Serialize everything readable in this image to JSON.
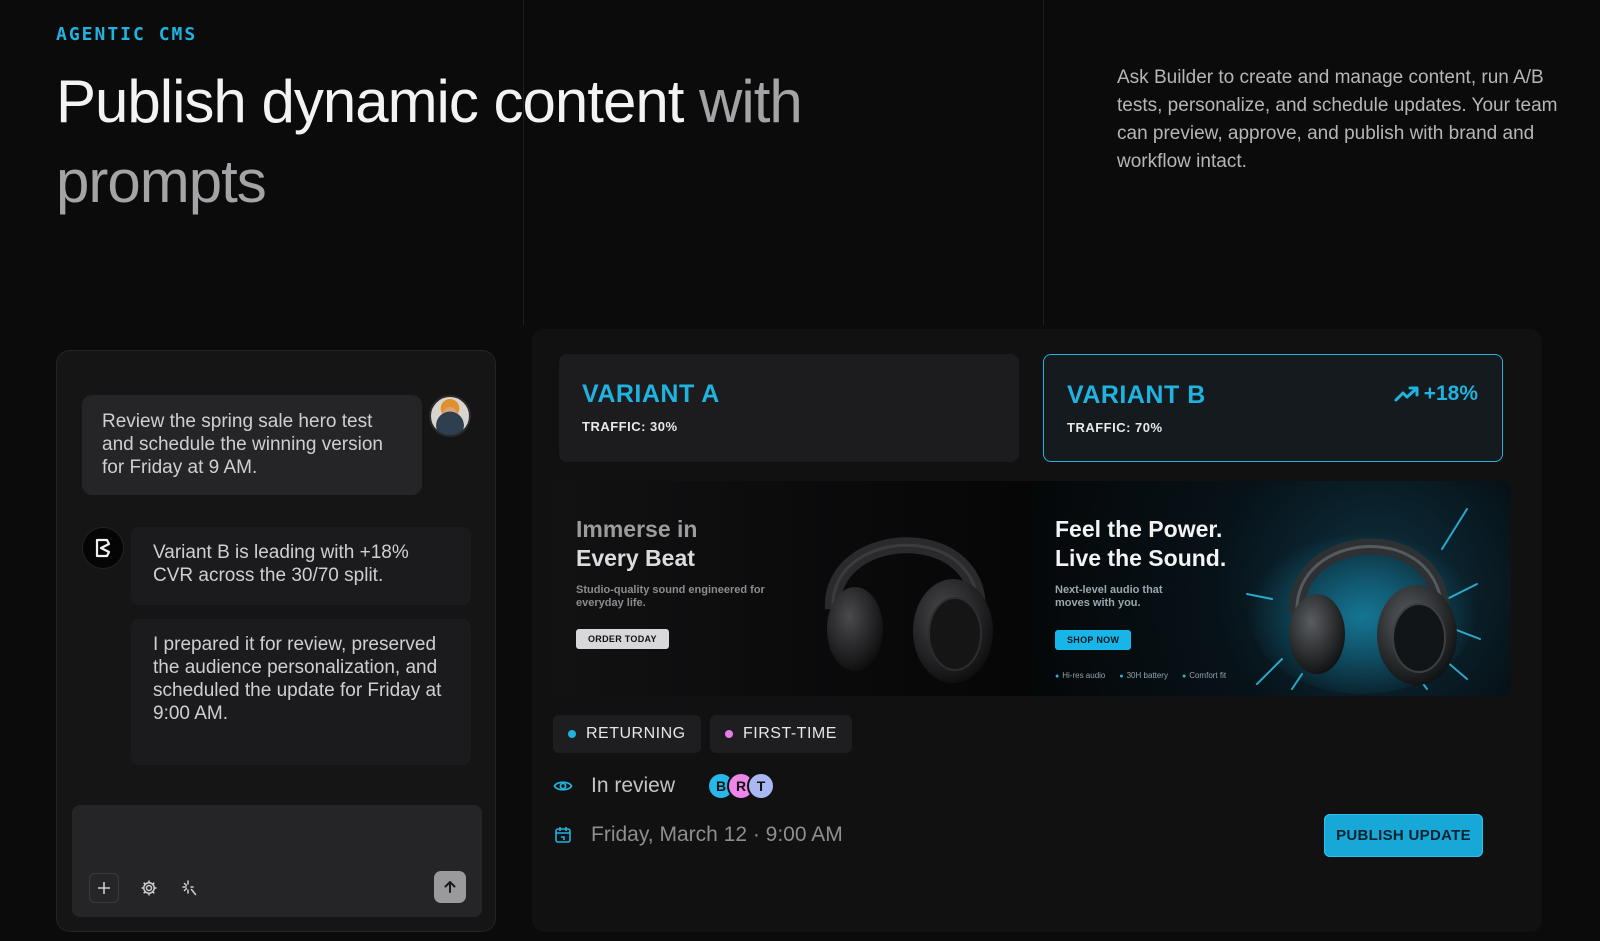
{
  "header": {
    "eyebrow": "AGENTIC CMS",
    "headline_main": "Publish dynamic content ",
    "headline_dim": "with prompts",
    "intro": "Ask Builder to create and manage content, run A/B tests, personalize, and schedule updates. Your team can preview, approve, and publish with brand and workflow intact."
  },
  "chat": {
    "user_message": "Review the spring sale hero test and schedule the winning version for Friday at 9 AM.",
    "bot_messages": [
      "Variant B is leading with +18% CVR across the 30/70 split.",
      "I prepared it for review, preserved the audience personalization, and scheduled the update for Friday at 9:00 AM."
    ],
    "composer_icons": [
      "plus-icon",
      "gear-icon",
      "sparkle-icon",
      "send-arrow-icon"
    ]
  },
  "variants": [
    {
      "title": "VARIANT A",
      "traffic": "TRAFFIC: 30%"
    },
    {
      "title": "VARIANT B",
      "traffic": "TRAFFIC: 70%",
      "lift": "+18%"
    }
  ],
  "hero_a": {
    "title_line1": "Immerse in",
    "title_line2": "Every Beat",
    "subtitle": "Studio-quality sound engineered for everyday life.",
    "cta": "ORDER TODAY"
  },
  "hero_b": {
    "title_line1": "Feel the Power.",
    "title_line2": "Live the Sound.",
    "subtitle": "Next-level audio that moves with you.",
    "cta": "SHOP NOW",
    "features": [
      "Hi-res audio",
      "30H battery",
      "Comfort fit"
    ]
  },
  "segments": [
    {
      "label": "RETURNING",
      "color": "#20b3e0"
    },
    {
      "label": "FIRST-TIME",
      "color": "#e77be8"
    }
  ],
  "status": {
    "review_label": "In review",
    "reviewers": [
      {
        "initial": "B",
        "color": "#27b8ea"
      },
      {
        "initial": "R",
        "color": "#ee86ea"
      },
      {
        "initial": "T",
        "color": "#a9b8f2"
      }
    ],
    "schedule": "Friday, March 12 · 9:00 AM"
  },
  "publish_label": "PUBLISH UPDATE",
  "colors": {
    "accent": "#20b3e0",
    "background": "#0b0b0c"
  }
}
